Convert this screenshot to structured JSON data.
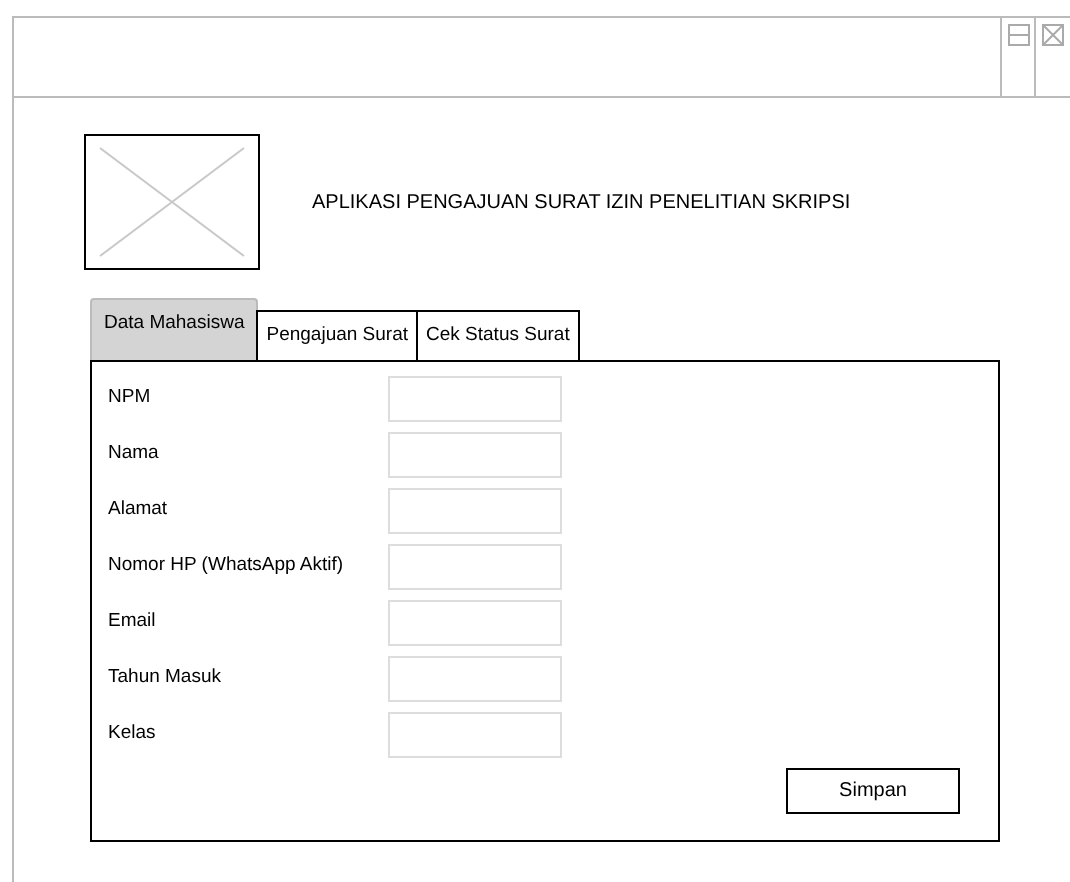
{
  "title": "APLIKASI PENGAJUAN SURAT IZIN PENELITIAN SKRIPSI",
  "tabs": [
    {
      "label": "Data Mahasiswa",
      "selected": true
    },
    {
      "label": "Pengajuan Surat",
      "selected": false
    },
    {
      "label": "Cek Status Surat",
      "selected": false
    }
  ],
  "fields": [
    {
      "label": "NPM"
    },
    {
      "label": "Nama"
    },
    {
      "label": "Alamat"
    },
    {
      "label": "Nomor HP (WhatsApp Aktif)"
    },
    {
      "label": "Email"
    },
    {
      "label": "Tahun Masuk"
    },
    {
      "label": "Kelas"
    }
  ],
  "button": "Simpan"
}
